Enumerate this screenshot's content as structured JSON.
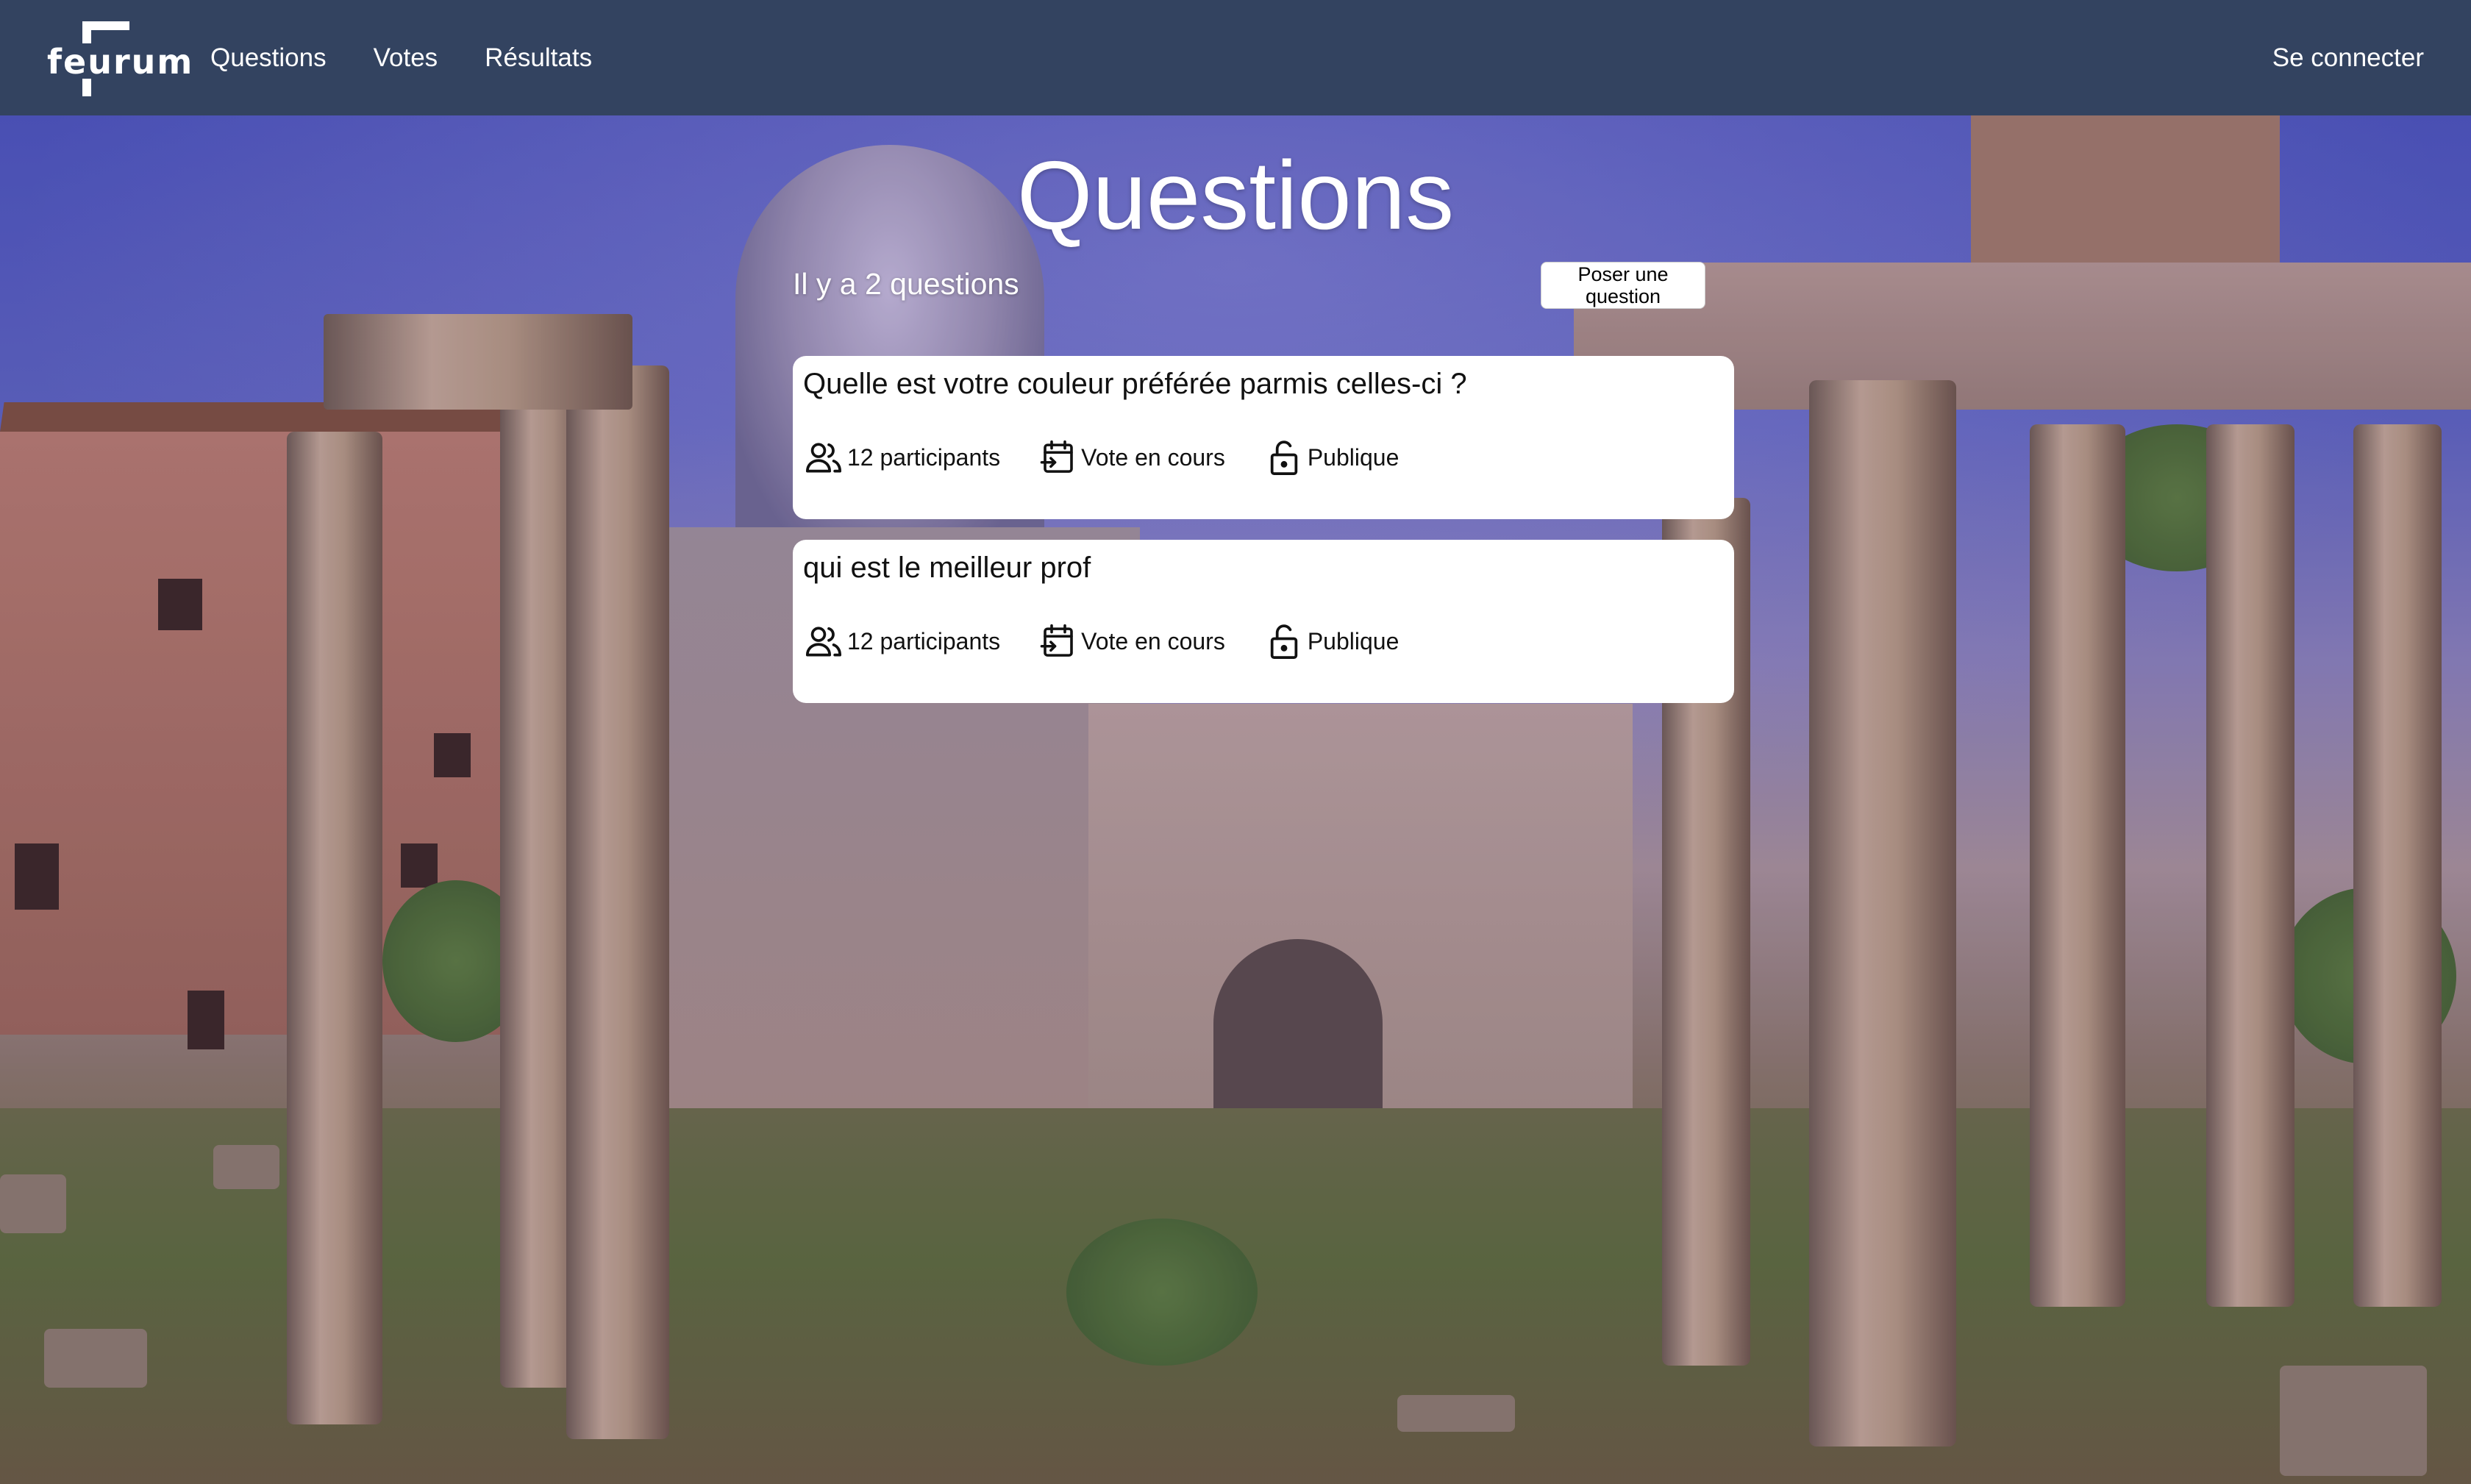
{
  "navbar": {
    "logo_text": "feurum",
    "links": [
      "Questions",
      "Votes",
      "Résultats"
    ],
    "login": "Se connecter"
  },
  "main": {
    "title": "Questions",
    "count_text": "Il y a 2 questions",
    "ask_button": "Poser une question"
  },
  "questions": [
    {
      "title": "Quelle est votre couleur préférée parmis celles-ci ?",
      "participants": "12 participants",
      "status": "Vote en cours",
      "visibility": "Publique"
    },
    {
      "title": "qui est le meilleur prof",
      "participants": "12 participants",
      "status": "Vote en cours",
      "visibility": "Publique"
    }
  ],
  "icons": {
    "participants": "users-icon",
    "status": "calendar-arrow-icon",
    "visibility": "unlock-icon"
  },
  "colors": {
    "navbar": "#334360",
    "card": "#ffffff",
    "text_on_bg": "#ffffff"
  }
}
